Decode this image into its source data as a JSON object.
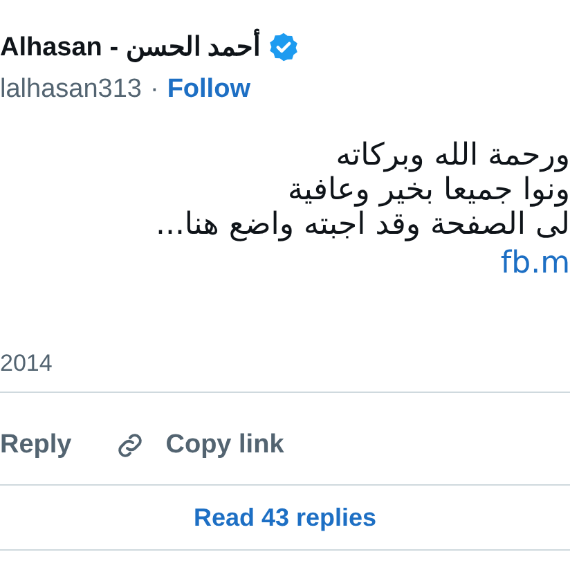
{
  "author": {
    "name": "Alhasan - أحمد الحسن",
    "verified": true,
    "handle": "lalhasan313",
    "separator": "·",
    "follow": "Follow"
  },
  "body": {
    "lines": [
      "ورحمة الله وبركاته",
      "ونوا جميعا بخير وعافية",
      "لى الصفحة وقد اجبته واضع هنا..."
    ],
    "link": "fb.m"
  },
  "date": "2014",
  "reply_button": {
    "label": "Reply"
  },
  "copy_link_button": {
    "label": "Copy link"
  },
  "read_replies": "Read 43 replies"
}
